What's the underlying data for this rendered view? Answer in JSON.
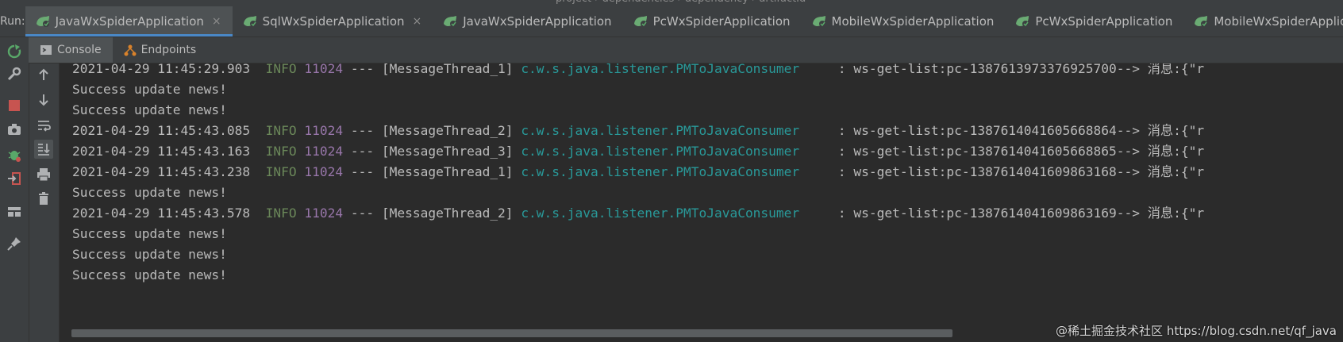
{
  "breadcrumb": [
    "project",
    "dependencies",
    "dependency",
    "artifactId"
  ],
  "run_label": "Run:",
  "tabs": [
    {
      "label": "JavaWxSpiderApplication",
      "active": true,
      "closable": true
    },
    {
      "label": "SqlWxSpiderApplication",
      "active": false,
      "closable": true
    },
    {
      "label": "JavaWxSpiderApplication",
      "active": false,
      "closable": false
    },
    {
      "label": "PcWxSpiderApplication",
      "active": false,
      "closable": false
    },
    {
      "label": "MobileWxSpiderApplication",
      "active": false,
      "closable": false
    },
    {
      "label": "PcWxSpiderApplication",
      "active": false,
      "closable": false
    },
    {
      "label": "MobileWxSpiderApplica",
      "active": false,
      "closable": false
    }
  ],
  "close_glyph": "×",
  "subtabs": {
    "console": "Console",
    "endpoints": "Endpoints"
  },
  "log": [
    {
      "type": "log",
      "ts": "2021-04-29 11:45:29.903",
      "level": "INFO",
      "pid": "11024",
      "sep": "---",
      "thread": "[MessageThread_1]",
      "logger": "c.w.s.java.listener.PMToJavaConsumer",
      "msg": ": ws-get-list:pc-1387613973376925700--> 消息:{\"r"
    },
    {
      "type": "text",
      "text": "Success update news!"
    },
    {
      "type": "text",
      "text": "Success update news!"
    },
    {
      "type": "log",
      "ts": "2021-04-29 11:45:43.085",
      "level": "INFO",
      "pid": "11024",
      "sep": "---",
      "thread": "[MessageThread_2]",
      "logger": "c.w.s.java.listener.PMToJavaConsumer",
      "msg": ": ws-get-list:pc-1387614041605668864--> 消息:{\"r"
    },
    {
      "type": "log",
      "ts": "2021-04-29 11:45:43.163",
      "level": "INFO",
      "pid": "11024",
      "sep": "---",
      "thread": "[MessageThread_3]",
      "logger": "c.w.s.java.listener.PMToJavaConsumer",
      "msg": ": ws-get-list:pc-1387614041605668865--> 消息:{\"r"
    },
    {
      "type": "log",
      "ts": "2021-04-29 11:45:43.238",
      "level": "INFO",
      "pid": "11024",
      "sep": "---",
      "thread": "[MessageThread_1]",
      "logger": "c.w.s.java.listener.PMToJavaConsumer",
      "msg": ": ws-get-list:pc-1387614041609863168--> 消息:{\"r"
    },
    {
      "type": "text",
      "text": "Success update news!"
    },
    {
      "type": "log",
      "ts": "2021-04-29 11:45:43.578",
      "level": "INFO",
      "pid": "11024",
      "sep": "---",
      "thread": "[MessageThread_2]",
      "logger": "c.w.s.java.listener.PMToJavaConsumer",
      "msg": ": ws-get-list:pc-1387614041609863169--> 消息:{\"r"
    },
    {
      "type": "text",
      "text": "Success update news!"
    },
    {
      "type": "text",
      "text": "Success update news!"
    },
    {
      "type": "text",
      "text": "Success update news!"
    }
  ],
  "watermark": "@稀土掘金技术社区\nhttps://blog.csdn.net/qf_java",
  "colors": {
    "background": "#2b2b2b",
    "panel": "#3c3f41",
    "info": "#6a8759",
    "pid": "#9876aa",
    "logger": "#299999",
    "active_underline": "#4a88c7"
  },
  "icons": {
    "left_toolbar": [
      "rerun-icon",
      "settings-wrench-icon",
      "stop-icon",
      "camera-icon",
      "debug-bug-icon",
      "exit-icon",
      "layout-icon",
      "pin-icon"
    ],
    "side_toolbar": [
      "arrow-up-icon",
      "arrow-down-icon",
      "soft-wrap-icon",
      "scroll-to-end-icon",
      "print-icon",
      "trash-icon"
    ]
  }
}
